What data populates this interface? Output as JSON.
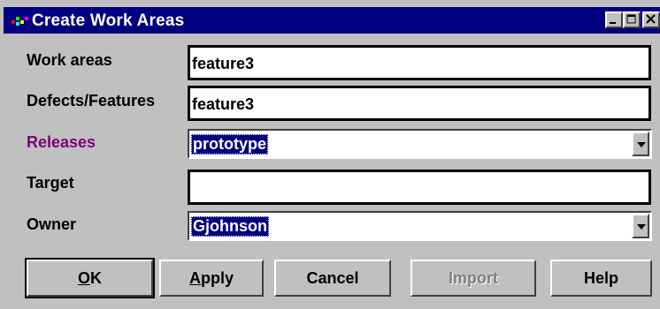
{
  "window": {
    "title": "Create Work Areas",
    "controls": [
      "minimize-icon",
      "maximize-icon",
      "close-icon"
    ]
  },
  "form": {
    "work_areas": {
      "label": "Work areas",
      "value": "feature3"
    },
    "defects_features": {
      "label": "Defects/Features",
      "value": "feature3"
    },
    "releases": {
      "label": "Releases",
      "value": "prototype",
      "label_color": "#800080"
    },
    "target": {
      "label": "Target",
      "value": ""
    },
    "owner": {
      "label": "Owner",
      "value": "Gjohnson"
    }
  },
  "buttons": {
    "ok": {
      "mnemonic": "O",
      "rest": "K"
    },
    "apply": {
      "mnemonic": "A",
      "rest": "pply"
    },
    "cancel": "Cancel",
    "import": "Import",
    "help": "Help"
  },
  "colors": {
    "title_bar": "#000080",
    "face": "#c0c0c0",
    "selection": "#000080"
  }
}
